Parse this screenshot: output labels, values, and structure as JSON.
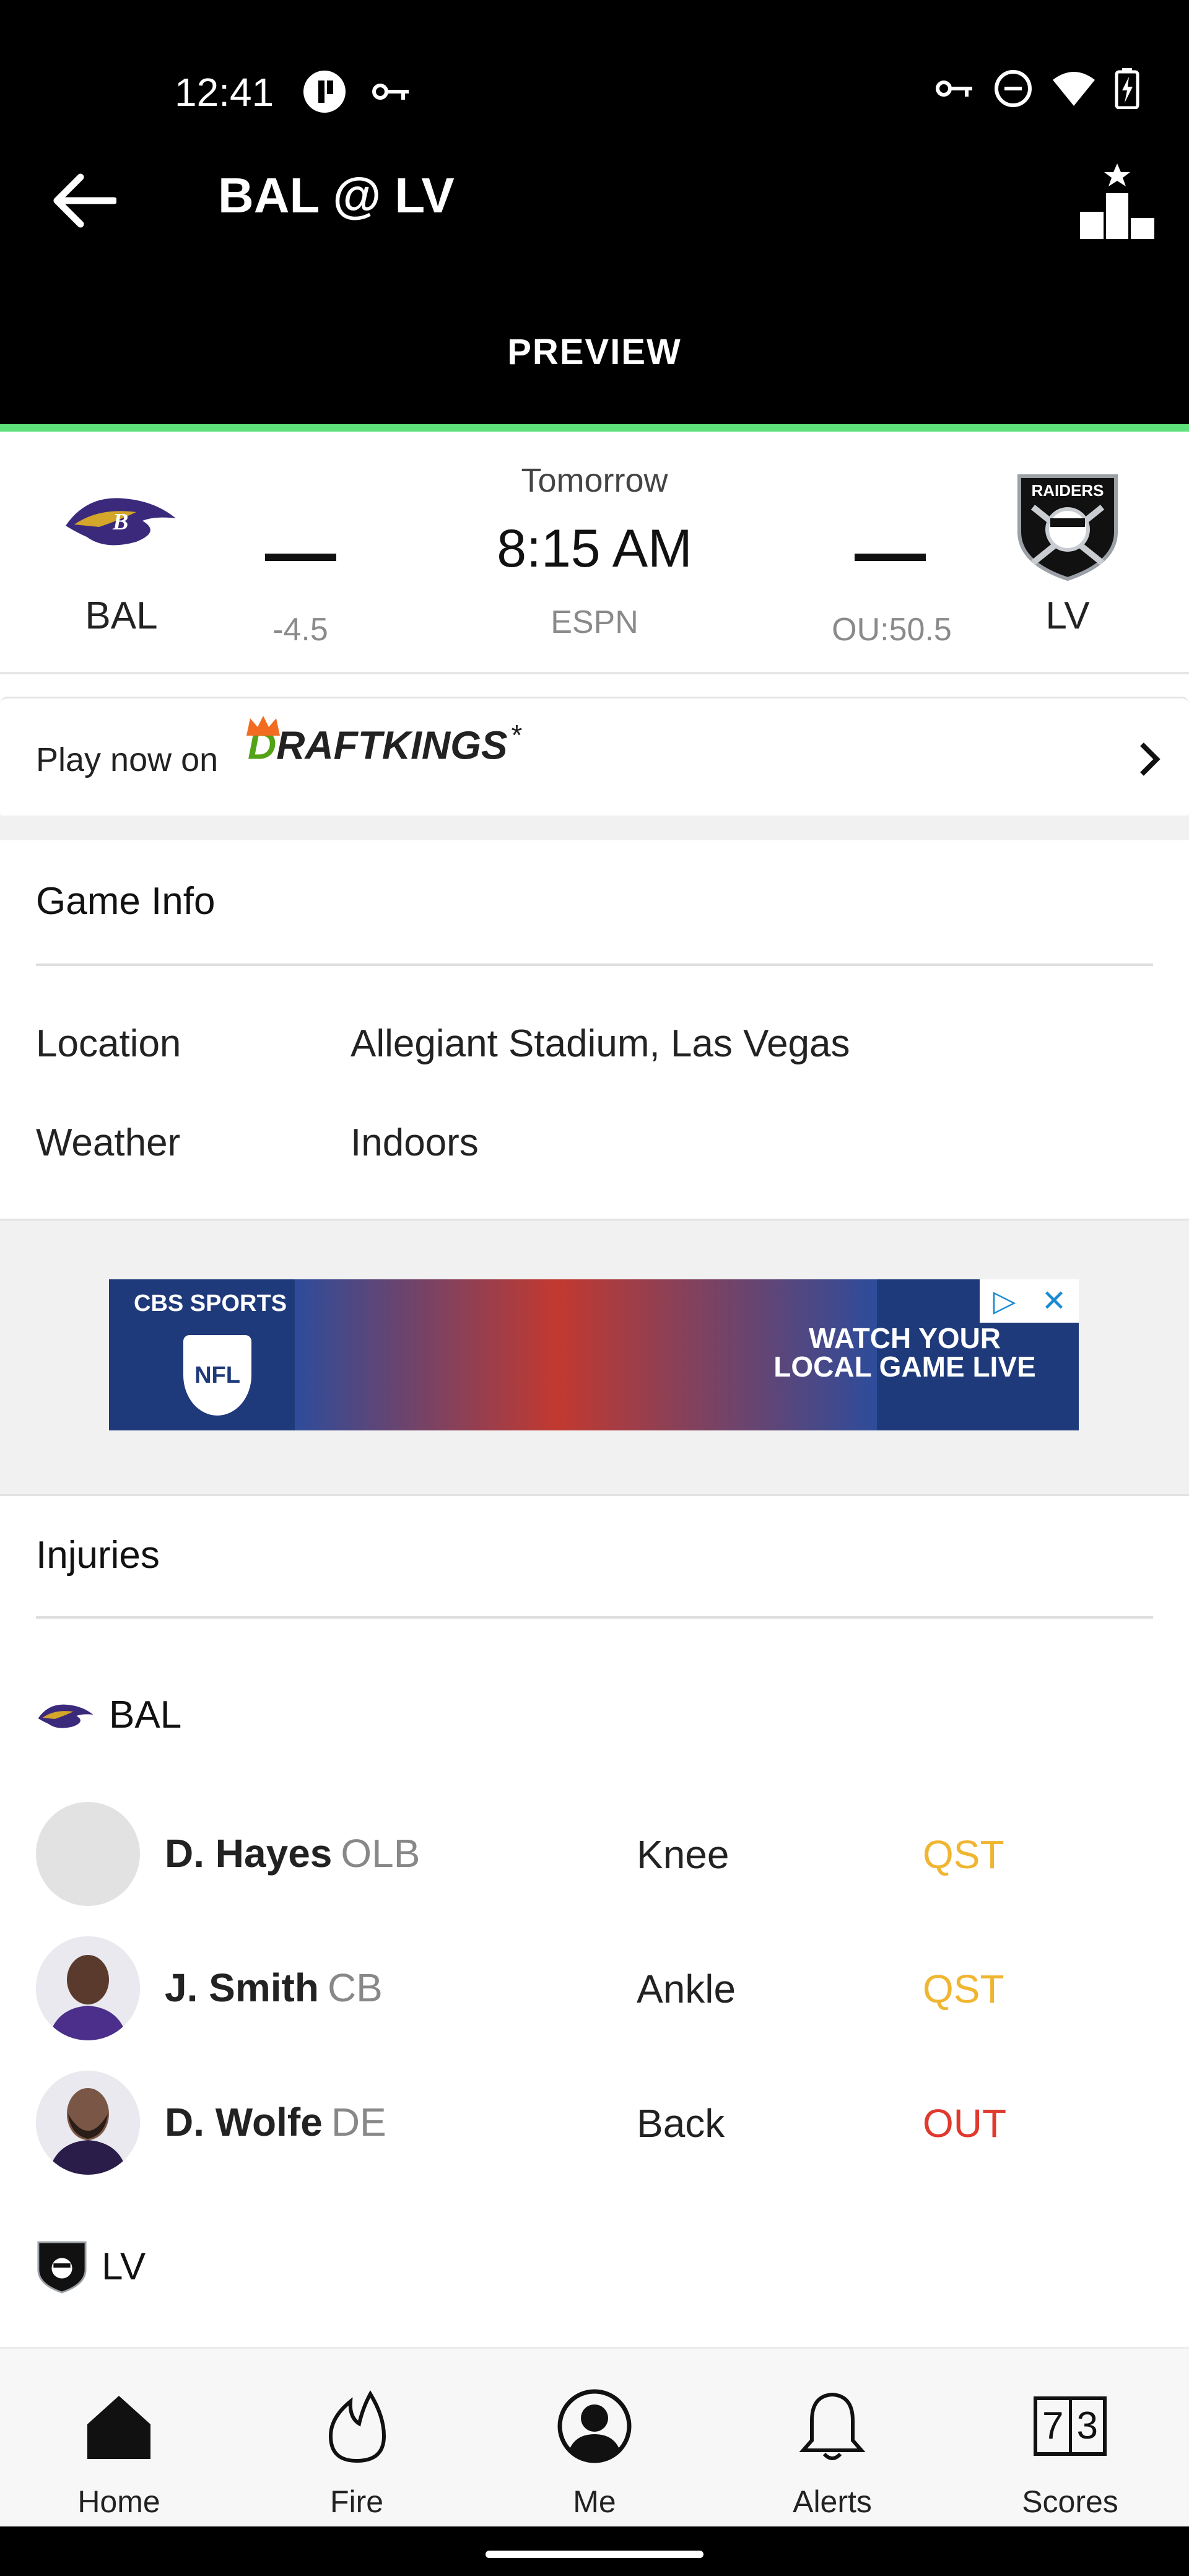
{
  "status_bar": {
    "time": "12:41"
  },
  "header": {
    "title": "BAL @ LV",
    "tab": "PREVIEW"
  },
  "game": {
    "day": "Tomorrow",
    "time": "8:15 AM",
    "network": "ESPN",
    "away": {
      "abbr": "BAL",
      "spread": "-4.5",
      "score": "—"
    },
    "home": {
      "abbr": "LV",
      "ou": "OU:50.5",
      "score": "—",
      "logo_text": "RAIDERS"
    }
  },
  "promo": {
    "text": "Play now on",
    "brand_first": "D",
    "brand_rest": "RAFTKINGS",
    "asterisk": "*"
  },
  "game_info": {
    "title": "Game Info",
    "rows": [
      {
        "label": "Location",
        "value": "Allegiant Stadium, Las Vegas"
      },
      {
        "label": "Weather",
        "value": "Indoors"
      }
    ]
  },
  "ad": {
    "brand": "CBS SPORTS",
    "badge": "NFL",
    "cta_line1": "WATCH YOUR",
    "cta_line2": "LOCAL GAME LIVE"
  },
  "injuries": {
    "title": "Injuries",
    "teams": [
      {
        "abbr": "BAL",
        "players": [
          {
            "name": "D. Hayes",
            "pos": "OLB",
            "injury": "Knee",
            "status": "QST"
          },
          {
            "name": "J. Smith",
            "pos": "CB",
            "injury": "Ankle",
            "status": "QST"
          },
          {
            "name": "D. Wolfe",
            "pos": "DE",
            "injury": "Back",
            "status": "OUT"
          }
        ]
      },
      {
        "abbr": "LV",
        "players": []
      }
    ]
  },
  "bottom_nav": [
    {
      "label": "Home",
      "icon": "home-icon"
    },
    {
      "label": "Fire",
      "icon": "fire-icon"
    },
    {
      "label": "Me",
      "icon": "person-icon"
    },
    {
      "label": "Alerts",
      "icon": "bell-icon"
    },
    {
      "label": "Scores",
      "icon": "scores-icon",
      "digits": [
        "7",
        "3"
      ]
    }
  ],
  "colors": {
    "accent": "#5ee07b",
    "qst": "#f0b531",
    "out": "#e0392d",
    "raven_purple": "#3b2a7c"
  }
}
